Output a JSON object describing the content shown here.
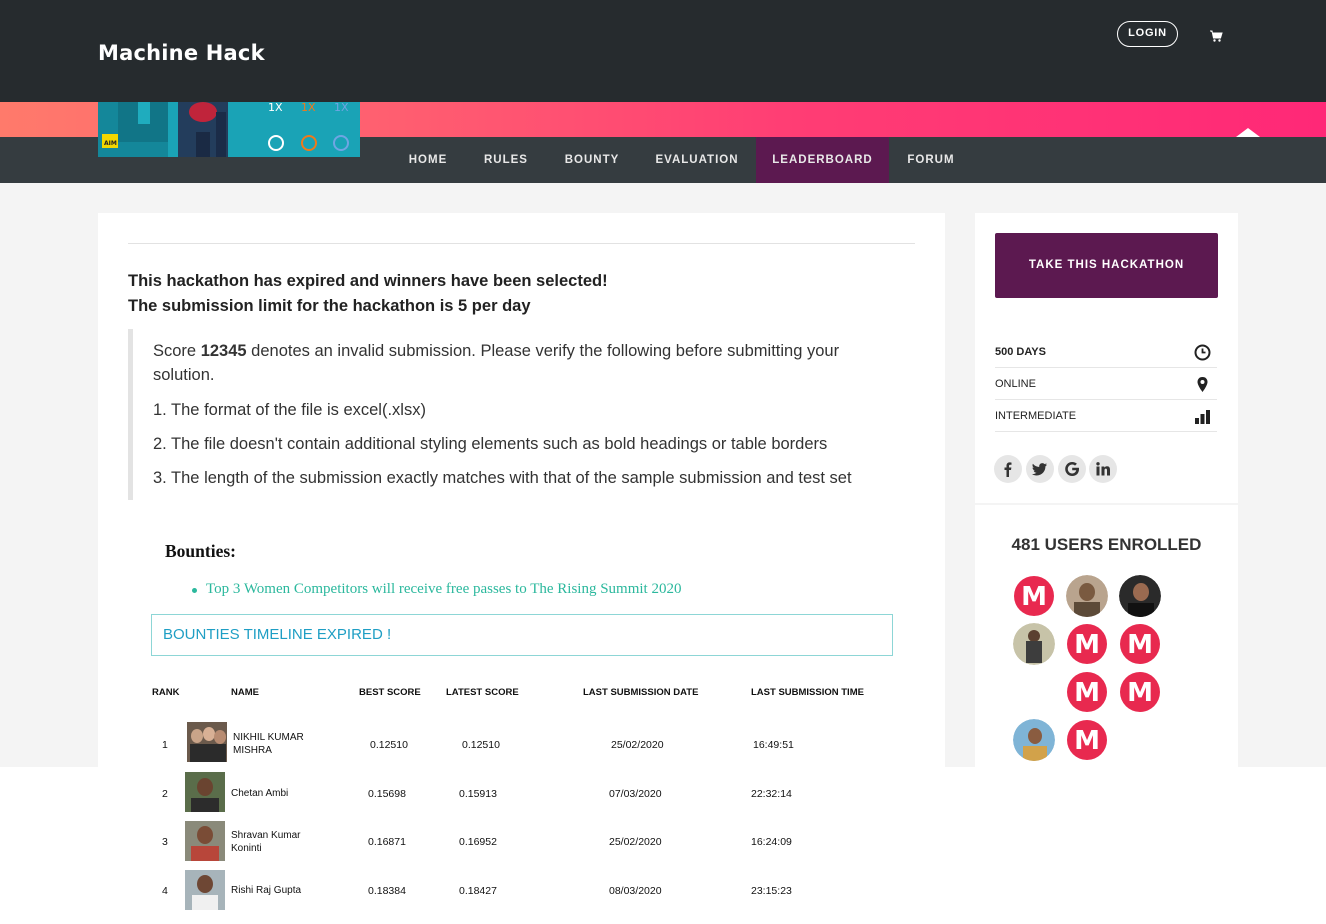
{
  "header": {
    "logo": "Machine Hack",
    "login_label": "LOGIN",
    "cart_icon": "cart-icon"
  },
  "nav": {
    "items": [
      {
        "label": "HOME"
      },
      {
        "label": "RULES"
      },
      {
        "label": "BOUNTY"
      },
      {
        "label": "EVALUATION"
      },
      {
        "label": "LEADERBOARD",
        "active": true
      },
      {
        "label": "FORUM"
      }
    ]
  },
  "banner": {
    "badge": "AIM",
    "tags": [
      "1X",
      "1X",
      "1X"
    ]
  },
  "main": {
    "notice_line1": "This hackathon has expired and winners have been selected!",
    "notice_line2": "The submission limit for the hackathon is 5 per day",
    "score_prefix": "Score ",
    "score_value": "12345",
    "score_line1_rest": " denotes an invalid submission. Please verify the following before submitting your",
    "score_line2": "solution.",
    "checks": [
      "1. The format of the file is excel(.xlsx)",
      "2. The file doesn't contain additional styling elements such as bold headings or table borders",
      "3. The length of the submission exactly matches with that of the sample submission and test set"
    ],
    "bounties_heading": "Bounties:",
    "bounty_item": "Top 3 Women Competitors will receive free passes to The Rising Summit 2020",
    "timeline_text": "BOUNTIES TIMELINE EXPIRED !"
  },
  "leaderboard": {
    "headers": [
      "RANK",
      "NAME",
      "BEST SCORE",
      "LATEST SCORE",
      "LAST SUBMISSION DATE",
      "LAST SUBMISSION TIME"
    ],
    "rows": [
      {
        "rank": "1",
        "name_l1": "NIKHIL KUMAR",
        "name_l2": "MISHRA",
        "best": "0.12510",
        "latest": "0.12510",
        "date": "25/02/2020",
        "time": "16:49:51"
      },
      {
        "rank": "2",
        "name_l1": "Chetan Ambi",
        "name_l2": "",
        "best": "0.15698",
        "latest": "0.15913",
        "date": "07/03/2020",
        "time": "22:32:14"
      },
      {
        "rank": "3",
        "name_l1": "Shravan Kumar",
        "name_l2": "Koninti",
        "best": "0.16871",
        "latest": "0.16952",
        "date": "25/02/2020",
        "time": "16:24:09"
      },
      {
        "rank": "4",
        "name_l1": "Rishi Raj Gupta",
        "name_l2": "",
        "best": "0.18384",
        "latest": "0.18427",
        "date": "08/03/2020",
        "time": "23:15:23"
      }
    ]
  },
  "sidebar": {
    "take_label": "TAKE THIS HACKATHON",
    "info": [
      {
        "label": "500 DAYS",
        "icon": "clock-icon"
      },
      {
        "label": "ONLINE",
        "icon": "map-pin-icon"
      },
      {
        "label": "INTERMEDIATE",
        "icon": "bar-level-icon"
      }
    ],
    "social": [
      "facebook-icon",
      "twitter-icon",
      "google-icon",
      "linkedin-icon"
    ],
    "enrolled": "481 USERS ENROLLED"
  },
  "colors": {
    "topbar": "#262b2e",
    "navbar": "#353c40",
    "active_tab": "#5c1950",
    "accent_pink": "#ff3d74",
    "bounty_green": "#2bb89d",
    "timeline_blue": "#1e9ec4"
  }
}
